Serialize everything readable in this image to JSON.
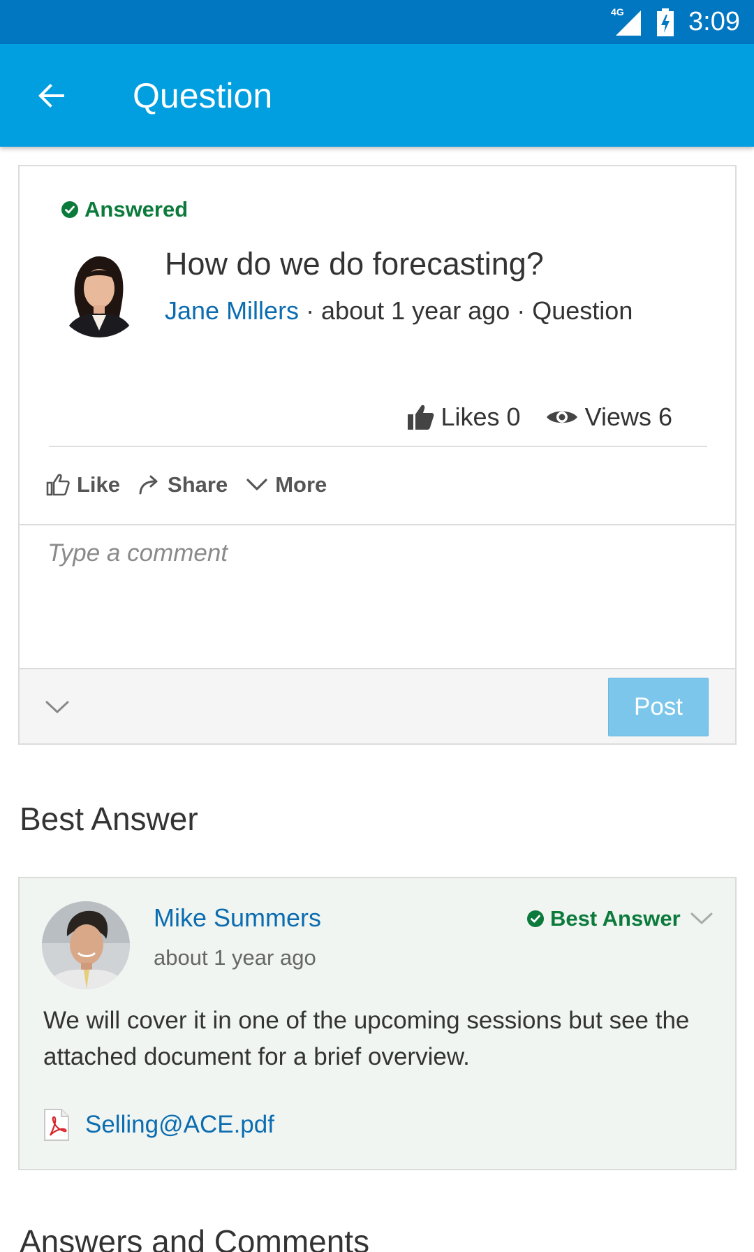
{
  "status_bar": {
    "network": "4G",
    "time": "3:09"
  },
  "app_bar": {
    "title": "Question"
  },
  "question": {
    "status": "Answered",
    "title": "How do we do forecasting?",
    "author": "Jane Millers",
    "meta_rest": " · about 1 year ago · Question",
    "likes_label": "Likes 0",
    "views_label": "Views 6",
    "actions": {
      "like": "Like",
      "share": "Share",
      "more": "More"
    },
    "comment_placeholder": "Type a comment",
    "post_label": "Post"
  },
  "best_answer": {
    "heading": "Best Answer",
    "author": "Mike Summers",
    "time": "about 1 year ago",
    "badge": "Best Answer",
    "body": "We will cover it in one of the upcoming sessions but see the attached document for a brief overview.",
    "attachment": "Selling@ACE.pdf"
  },
  "answers_heading": "Answers and Comments",
  "colors": {
    "status_bar": "#0176c1",
    "app_bar": "#019ee0",
    "answered_green": "#0b7a3b",
    "link_blue": "#0b6cb0",
    "post_button": "#7cc6ec",
    "answer_card_bg": "#f0f5f2"
  },
  "icons": [
    "signal-icon",
    "battery-icon",
    "back-arrow-icon",
    "check-circle-icon",
    "thumbs-up-icon",
    "eye-icon",
    "share-icon",
    "chevron-down-icon",
    "pdf-icon"
  ]
}
